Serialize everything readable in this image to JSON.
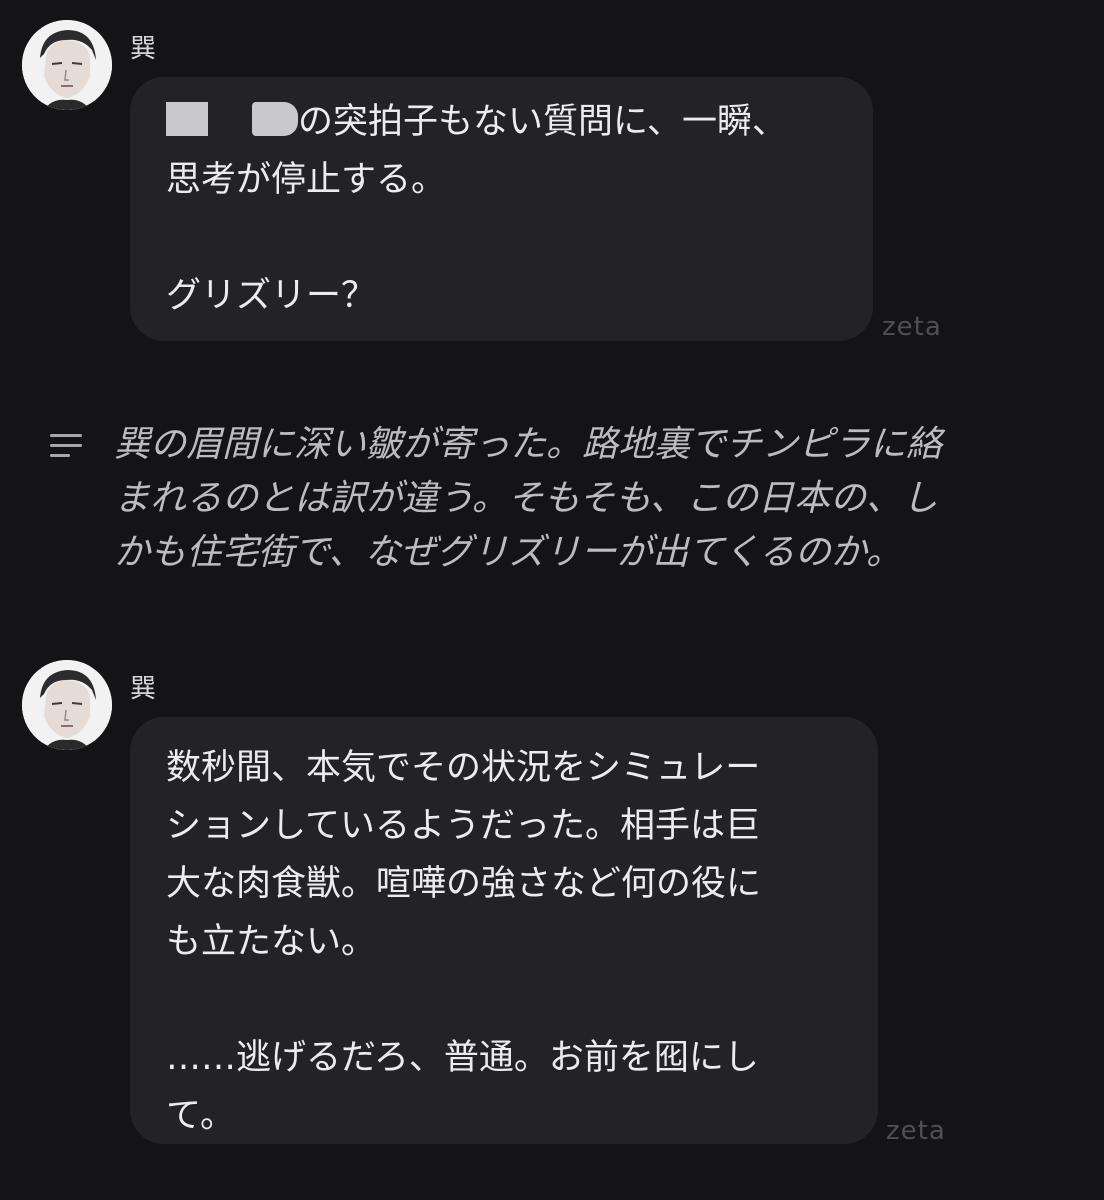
{
  "messages": [
    {
      "type": "character",
      "name": "巽",
      "lines": [
        "の突拍子もない質問に、一瞬、",
        "思考が停止する。",
        "",
        "グリズリー？"
      ],
      "footer": "zeta"
    },
    {
      "type": "narration",
      "icon": "menu-lines-icon",
      "lines": [
        "巽の眉間に深い皺が寄った。路地裏でチンピラに絡",
        "まれるのとは訳が違う。そもそも、この日本の、し",
        "かも住宅街で、なぜグリズリーが出てくるのか。"
      ]
    },
    {
      "type": "character",
      "name": "巽",
      "lines": [
        "数秒間、本気でその状況をシミュレー",
        "ションしているようだった。相手は巨",
        "大な肉食獣。喧嘩の強さなど何の役に",
        "も立たない。",
        "",
        "……逃げるだろ、普通。お前を囮にし",
        "て。"
      ],
      "footer": "zeta"
    }
  ],
  "colors": {
    "background": "#141416",
    "bubble": "#232326",
    "text": "#ececee",
    "narration_text": "#bcbcc0",
    "footer_text": "#4f4f54"
  }
}
